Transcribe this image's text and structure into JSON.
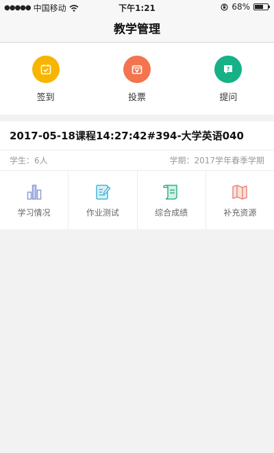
{
  "status": {
    "carrier": "中国移动",
    "time": "下午1:21",
    "battery": "68%",
    "battery_level": 0.68
  },
  "nav": {
    "title": "教学管理"
  },
  "quick_actions": [
    {
      "label": "签到",
      "icon": "checkin-icon",
      "color": "#f7b500"
    },
    {
      "label": "投票",
      "icon": "vote-icon",
      "color": "#f3744f"
    },
    {
      "label": "提问",
      "icon": "question-icon",
      "color": "#16b186"
    }
  ],
  "course": {
    "title": "2017-05-18课程14:27:42#394-大学英语040",
    "students": "学生：6人",
    "term": "学期：2017学年春季学期",
    "actions": [
      {
        "label": "学习情况",
        "icon": "bar-chart-icon",
        "color": "#8a9ad6"
      },
      {
        "label": "作业测试",
        "icon": "homework-icon",
        "color": "#43b7d8"
      },
      {
        "label": "综合成绩",
        "icon": "scroll-icon",
        "color": "#2fb38a"
      },
      {
        "label": "补充资源",
        "icon": "map-icon",
        "color": "#e8897c"
      }
    ]
  }
}
